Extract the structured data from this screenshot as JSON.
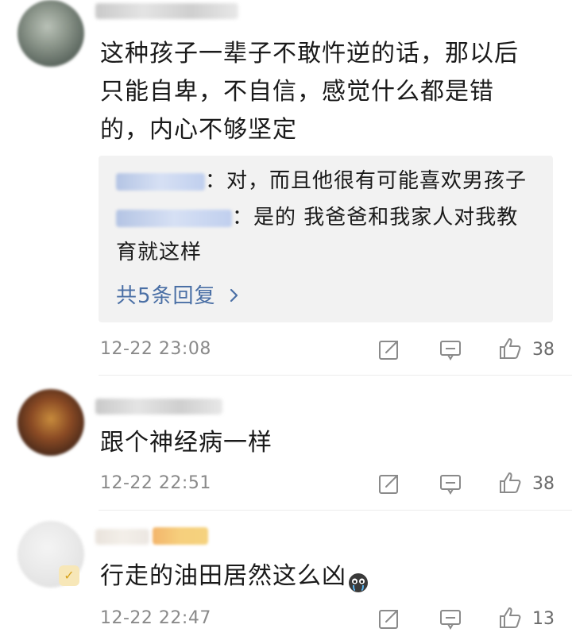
{
  "comments": [
    {
      "text": "这种孩子一辈子不敢忤逆的话，那以后只能自卑，不自信，感觉什么都是错的，内心不够坚定",
      "replies": [
        {
          "text": "：对，而且他很有可能喜欢男孩子"
        },
        {
          "text": "：是的 我爸爸和我家人对我教育就这样"
        }
      ],
      "more_replies": "共5条回复",
      "time": "12-22 23:08",
      "likes": "38"
    },
    {
      "text": "跟个神经病一样",
      "time": "12-22 22:51",
      "likes": "38"
    },
    {
      "text": "行走的油田居然这么凶",
      "time": "12-22 22:47",
      "likes": "13"
    }
  ],
  "icons": {
    "share": "share-icon",
    "comment": "comment-icon",
    "like": "thumbs-up-icon",
    "chevron": "chevron-right-icon",
    "emoji": "crying-face-icon",
    "vip": "vip-badge-icon"
  },
  "colors": {
    "link": "#4a6fa5",
    "meta": "#8a8a8a",
    "reply_bg": "#f2f2f2"
  }
}
